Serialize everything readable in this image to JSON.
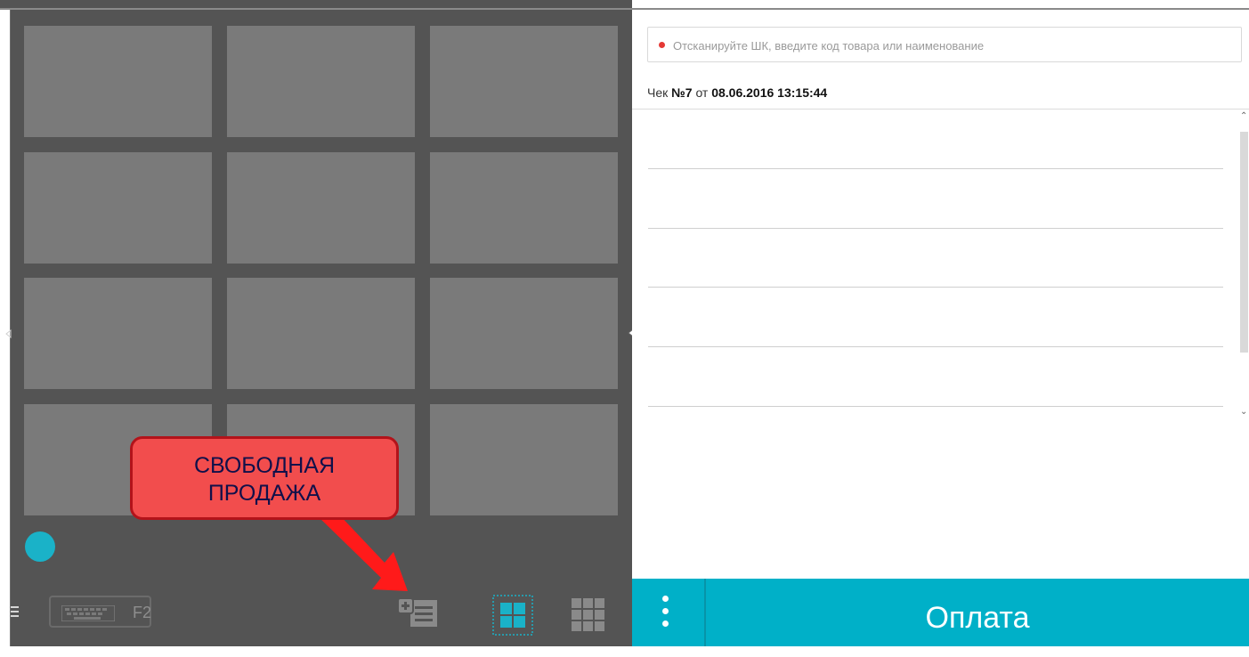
{
  "search": {
    "placeholder": "Отсканируйте ШК, введите код товара или наименование"
  },
  "receipt": {
    "prefix": "Чек",
    "number": "№7",
    "from": "от",
    "datetime": "08.06.2016 13:15:44"
  },
  "callout": {
    "line1": "СВОБОДНАЯ",
    "line2": "ПРОДАЖА"
  },
  "toolbar": {
    "keyboard_label": "F2"
  },
  "payment": {
    "label": "Оплата"
  },
  "colors": {
    "accent": "#00b0c8",
    "callout_fill": "#f24d4d",
    "callout_border": "#b3131a",
    "arrow": "#ff1a1a"
  },
  "icons": [
    "menu-icon",
    "keyboard-icon",
    "free-sale-icon",
    "grid-4-icon",
    "grid-9-icon",
    "more-vertical-icon"
  ]
}
